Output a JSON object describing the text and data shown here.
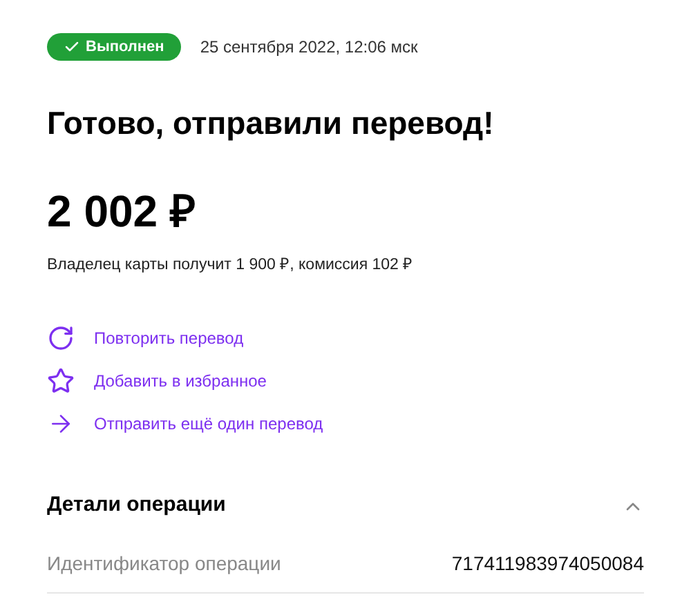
{
  "status": {
    "label": "Выполнен",
    "kind": "success"
  },
  "datetime": "25 сентября 2022, 12:06 мск",
  "title": "Готово, отправили перевод!",
  "amount": "2 002 ₽",
  "note": "Владелец карты получит 1 900 ₽, комиссия 102 ₽",
  "actions": [
    {
      "kind": "repeat",
      "label": "Повторить перевод"
    },
    {
      "kind": "favorite",
      "label": "Добавить в избранное"
    },
    {
      "kind": "send",
      "label": "Отправить ещё один перевод"
    }
  ],
  "details": {
    "title": "Детали операции",
    "expanded": true,
    "rows": [
      {
        "label": "Идентификатор операции",
        "value": "717411983974050084"
      }
    ]
  }
}
